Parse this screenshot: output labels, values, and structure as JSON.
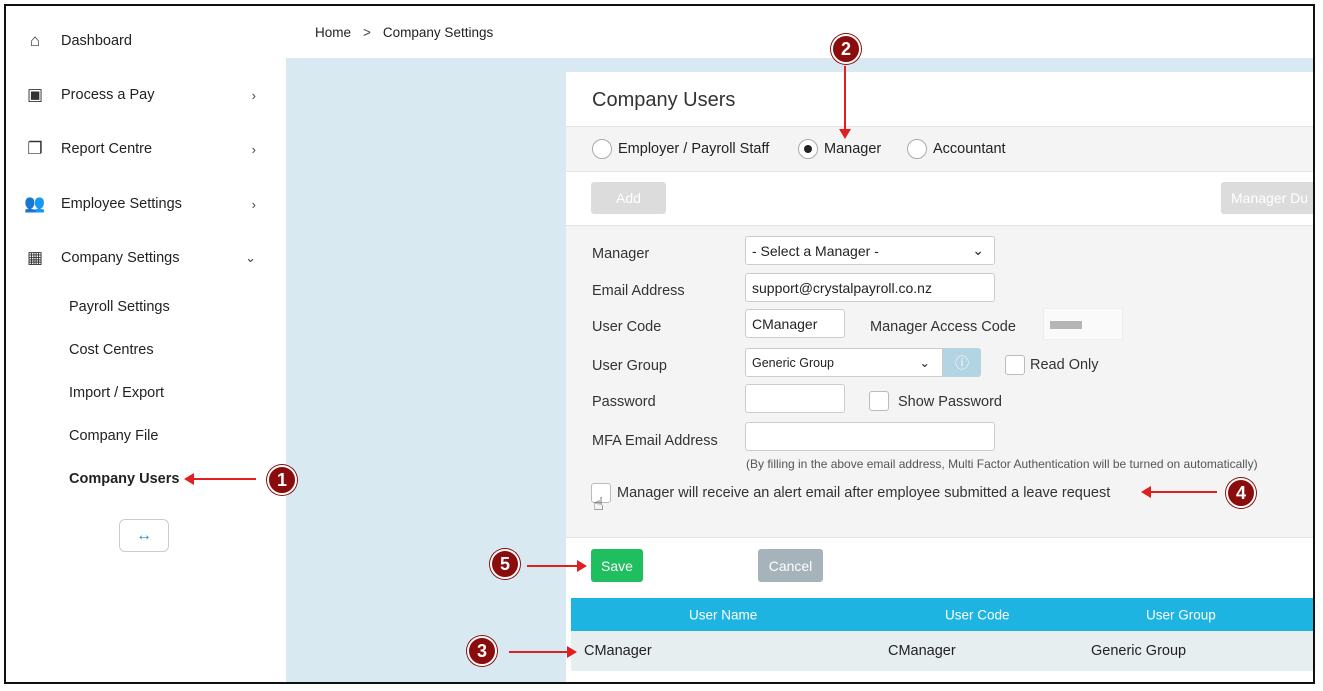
{
  "sidebar": {
    "items": [
      {
        "label": "Dashboard",
        "icon": "home-icon"
      },
      {
        "label": "Process a Pay",
        "icon": "calendar-icon"
      },
      {
        "label": "Report Centre",
        "icon": "copy-icon"
      },
      {
        "label": "Employee Settings",
        "icon": "people-icon"
      },
      {
        "label": "Company Settings",
        "icon": "building-icon"
      }
    ],
    "sub_items": [
      "Payroll Settings",
      "Cost Centres",
      "Import / Export",
      "Company File",
      "Company Users"
    ],
    "toggle_icon": "↔"
  },
  "breadcrumb": {
    "home": "Home",
    "sep": ">",
    "current": "Company Settings"
  },
  "card": {
    "title": "Company Users",
    "radios": [
      {
        "label": "Employer / Payroll Staff",
        "checked": false
      },
      {
        "label": "Manager",
        "checked": true
      },
      {
        "label": "Accountant",
        "checked": false
      }
    ],
    "add_label": "Add",
    "manager_dup_label": "Manager Du",
    "form": {
      "manager_label": "Manager",
      "manager_value": "- Select a Manager -",
      "email_label": "Email Address",
      "email_value": "support@crystalpayroll.co.nz",
      "usercode_label": "User Code",
      "usercode_value": "CManager",
      "access_code_label": "Manager Access Code",
      "usergroup_label": "User Group",
      "usergroup_value": "Generic Group",
      "readonly_label": "Read Only",
      "password_label": "Password",
      "show_password_label": "Show Password",
      "mfa_label": "MFA Email Address",
      "mfa_value": "",
      "mfa_note": "(By filling in the above email address, Multi Factor Authentication will be turned on automatically)",
      "alert_label": "Manager will receive an alert email after employee submitted a leave request"
    },
    "save_label": "Save",
    "cancel_label": "Cancel",
    "table": {
      "headers": [
        "User Name",
        "User Code",
        "User Group"
      ],
      "rows": [
        [
          "CManager",
          "CManager",
          "Generic Group"
        ]
      ]
    }
  },
  "annotations": [
    "1",
    "2",
    "3",
    "4",
    "5"
  ],
  "colors": {
    "accent": "#1db4e2",
    "save": "#1fbe5e",
    "badge": "#8b0c0c",
    "arrow": "#e02020"
  }
}
